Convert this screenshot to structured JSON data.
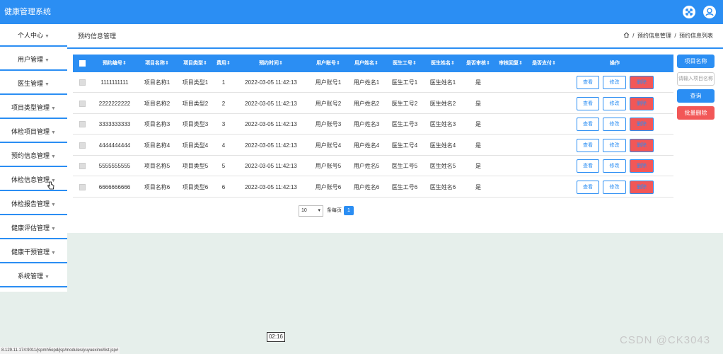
{
  "app": {
    "title": "健康管理系统"
  },
  "colors": {
    "primary": "#2b8ef3",
    "danger": "#f25757",
    "lower_bg": "#e6efeb"
  },
  "icons": {
    "fullscreen": "fullscreen-icon",
    "user": "user-icon",
    "home": "home-icon"
  },
  "sidebar": {
    "items": [
      {
        "label": "个人中心"
      },
      {
        "label": "用户管理"
      },
      {
        "label": "医生管理"
      },
      {
        "label": "项目类型管理"
      },
      {
        "label": "体检项目管理"
      },
      {
        "label": "预约信息管理"
      },
      {
        "label": "体检信息管理"
      },
      {
        "label": "体检报告管理"
      },
      {
        "label": "健康评估管理"
      },
      {
        "label": "健康干预管理"
      },
      {
        "label": "系统管理"
      }
    ]
  },
  "header": {
    "page_title": "预约信息管理",
    "breadcrumb": [
      "预约信息管理",
      "预约信息列表"
    ]
  },
  "table": {
    "columns": [
      "预约编号",
      "项目名称",
      "项目类型",
      "费用",
      "预约时间",
      "用户账号",
      "用户姓名",
      "医生工号",
      "医生姓名",
      "是否审核",
      "审核回复",
      "是否支付",
      "操作"
    ],
    "rows": [
      [
        "1111111111",
        "项目名称1",
        "项目类型1",
        "1",
        "2022-03-05 11:42:13",
        "用户账号1",
        "用户姓名1",
        "医生工号1",
        "医生姓名1",
        "是",
        "",
        ""
      ],
      [
        "2222222222",
        "项目名称2",
        "项目类型2",
        "2",
        "2022-03-05 11:42:13",
        "用户账号2",
        "用户姓名2",
        "医生工号2",
        "医生姓名2",
        "是",
        "",
        ""
      ],
      [
        "3333333333",
        "项目名称3",
        "项目类型3",
        "3",
        "2022-03-05 11:42:13",
        "用户账号3",
        "用户姓名3",
        "医生工号3",
        "医生姓名3",
        "是",
        "",
        ""
      ],
      [
        "4444444444",
        "项目名称4",
        "项目类型4",
        "4",
        "2022-03-05 11:42:13",
        "用户账号4",
        "用户姓名4",
        "医生工号4",
        "医生姓名4",
        "是",
        "",
        ""
      ],
      [
        "5555555555",
        "项目名称5",
        "项目类型5",
        "5",
        "2022-03-05 11:42:13",
        "用户账号5",
        "用户姓名5",
        "医生工号5",
        "医生姓名5",
        "是",
        "",
        ""
      ],
      [
        "6666666666",
        "项目名称6",
        "项目类型6",
        "6",
        "2022-03-05 11:42:13",
        "用户账号6",
        "用户姓名6",
        "医生工号6",
        "医生姓名6",
        "是",
        "",
        ""
      ]
    ],
    "actions": {
      "view": "查看",
      "edit": "修改",
      "delete": "删除"
    }
  },
  "pager": {
    "page_size": "10",
    "per_page_label": "条每页",
    "current_page": "1"
  },
  "right_panel": {
    "field_label": "项目名称",
    "input_placeholder": "请输入项目名称",
    "search_label": "查询",
    "batch_delete_label": "批量删除"
  },
  "status": {
    "url": "8.129.11.174:9011/jspmh5opd/jsp/modules/yuyuexinxi/list.jsp#",
    "timer": "02:16",
    "watermark": "CSDN @CK3043"
  }
}
